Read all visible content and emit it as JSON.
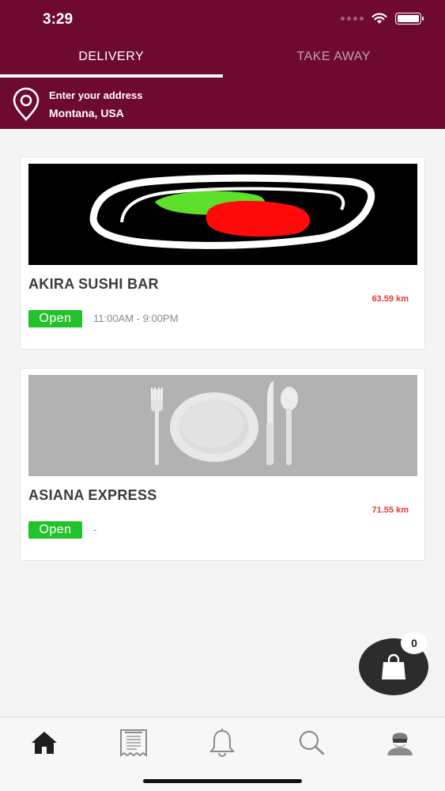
{
  "status_bar": {
    "time": "3:29"
  },
  "tabs": [
    {
      "label": "DELIVERY",
      "active": true
    },
    {
      "label": "TAKE AWAY",
      "active": false
    }
  ],
  "address": {
    "label": "Enter your address",
    "value": "Montana, USA"
  },
  "restaurants": [
    {
      "name": "AKIRA SUSHI BAR",
      "distance": "63.59 km",
      "status": "Open",
      "hours": "11:00AM - 9:00PM"
    },
    {
      "name": "ASIANA EXPRESS",
      "distance": "71.55 km",
      "status": "Open",
      "hours": "-"
    }
  ],
  "cart": {
    "count": "0"
  },
  "bottom_nav": [
    {
      "icon": "home-icon",
      "active": true
    },
    {
      "icon": "receipt-icon",
      "active": false
    },
    {
      "icon": "bell-icon",
      "active": false
    },
    {
      "icon": "search-icon",
      "active": false
    },
    {
      "icon": "profile-icon",
      "active": false
    }
  ],
  "colors": {
    "header": "#6e0a30",
    "open_badge": "#22c22b",
    "distance": "#e53935",
    "cart": "#2c2c2c"
  }
}
